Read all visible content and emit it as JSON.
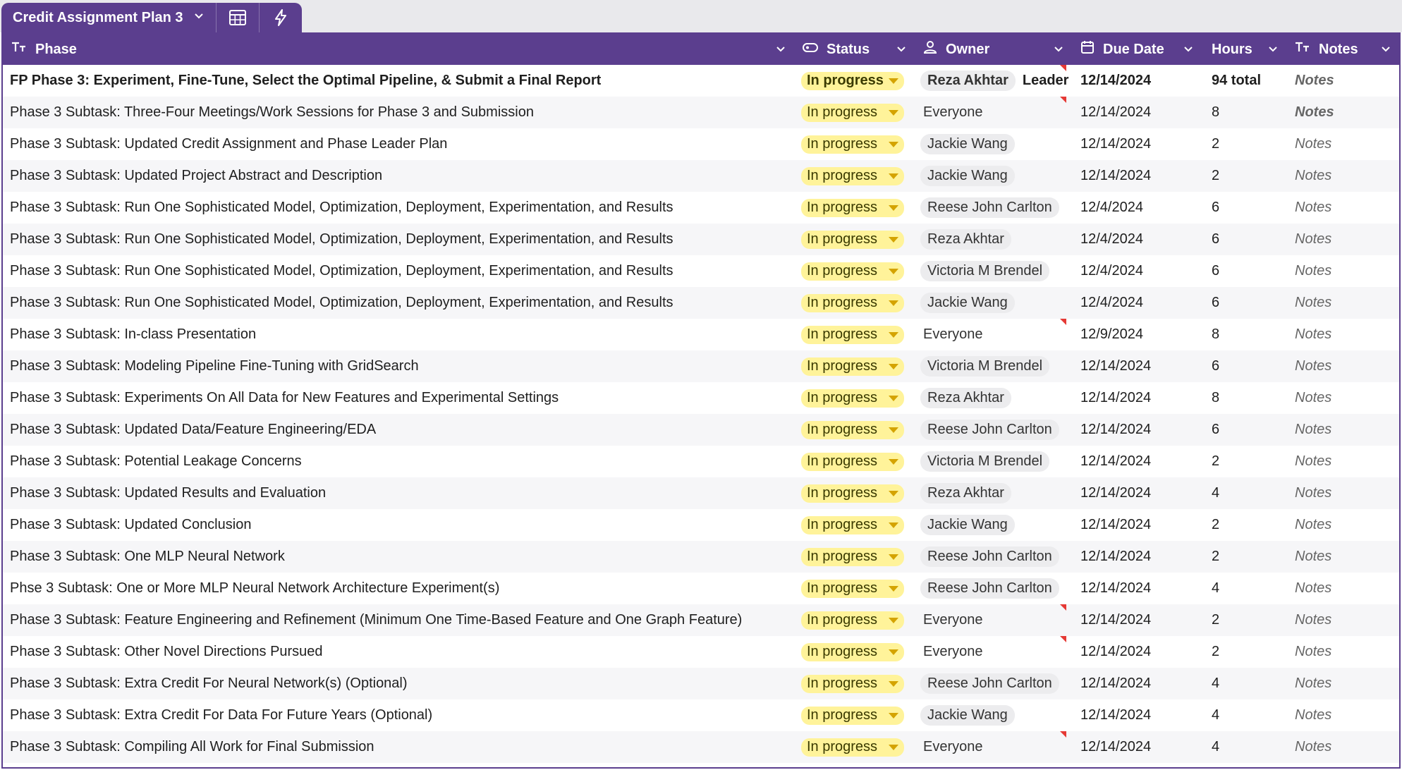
{
  "tab": {
    "title": "Credit Assignment Plan 3"
  },
  "columns": {
    "phase": "Phase",
    "status": "Status",
    "owner": "Owner",
    "due": "Due Date",
    "hours": "Hours",
    "notes": "Notes"
  },
  "rows": [
    {
      "phase": "FP Phase 3: Experiment, Fine-Tune, Select the Optimal Pipeline, & Submit a Final Report",
      "status": "In progress",
      "owner": "Reza Akhtar",
      "owner_extra": "Leader",
      "due": "12/14/2024",
      "hours": "94 total",
      "notes": "Notes"
    },
    {
      "phase": "Phase 3 Subtask: Three-Four Meetings/Work Sessions for Phase 3 and Submission",
      "status": "In progress",
      "owner": "Everyone",
      "due": "12/14/2024",
      "hours": "8",
      "notes": "Notes"
    },
    {
      "phase": "Phase 3 Subtask: Updated Credit Assignment and Phase Leader Plan",
      "status": "In progress",
      "owner": "Jackie Wang",
      "due": "12/14/2024",
      "hours": "2",
      "notes": "Notes"
    },
    {
      "phase": "Phase 3 Subtask: Updated Project Abstract and Description",
      "status": "In progress",
      "owner": "Jackie Wang",
      "due": "12/14/2024",
      "hours": "2",
      "notes": "Notes"
    },
    {
      "phase": "Phase 3 Subtask: Run One Sophisticated Model, Optimization, Deployment, Experimentation, and Results",
      "status": "In progress",
      "owner": "Reese John Carlton",
      "due": "12/4/2024",
      "hours": "6",
      "notes": "Notes"
    },
    {
      "phase": "Phase 3 Subtask: Run One Sophisticated Model, Optimization, Deployment, Experimentation, and Results",
      "status": "In progress",
      "owner": "Reza Akhtar",
      "due": "12/4/2024",
      "hours": "6",
      "notes": "Notes"
    },
    {
      "phase": "Phase 3 Subtask: Run One Sophisticated Model, Optimization, Deployment, Experimentation, and Results",
      "status": "In progress",
      "owner": "Victoria M Brendel",
      "due": "12/4/2024",
      "hours": "6",
      "notes": "Notes"
    },
    {
      "phase": "Phase 3 Subtask: Run One Sophisticated Model, Optimization, Deployment, Experimentation, and Results",
      "status": "In progress",
      "owner": "Jackie Wang",
      "due": "12/4/2024",
      "hours": "6",
      "notes": "Notes"
    },
    {
      "phase": "Phase 3 Subtask:  In-class Presentation",
      "status": "In progress",
      "owner": "Everyone",
      "due": "12/9/2024",
      "hours": "8",
      "notes": "Notes"
    },
    {
      "phase": "Phase 3 Subtask: Modeling Pipeline Fine-Tuning with GridSearch",
      "status": "In progress",
      "owner": "Victoria M Brendel",
      "due": "12/14/2024",
      "hours": "6",
      "notes": "Notes"
    },
    {
      "phase": "Phase 3 Subtask: Experiments On All Data for New Features and Experimental Settings",
      "status": "In progress",
      "owner": "Reza Akhtar",
      "due": "12/14/2024",
      "hours": "8",
      "notes": "Notes"
    },
    {
      "phase": "Phase 3 Subtask: Updated Data/Feature Engineering/EDA",
      "status": "In progress",
      "owner": "Reese John Carlton",
      "due": "12/14/2024",
      "hours": "6",
      "notes": "Notes"
    },
    {
      "phase": "Phase 3 Subtask: Potential Leakage Concerns",
      "status": "In progress",
      "owner": "Victoria M Brendel",
      "due": "12/14/2024",
      "hours": "2",
      "notes": "Notes"
    },
    {
      "phase": "Phase 3 Subtask: Updated Results and Evaluation",
      "status": "In progress",
      "owner": "Reza Akhtar",
      "due": "12/14/2024",
      "hours": "4",
      "notes": "Notes"
    },
    {
      "phase": "Phase 3 Subtask: Updated Conclusion",
      "status": "In progress",
      "owner": "Jackie Wang",
      "due": "12/14/2024",
      "hours": "2",
      "notes": "Notes"
    },
    {
      "phase": "Phase 3 Subtask: One MLP Neural Network",
      "status": "In progress",
      "owner": "Reese John Carlton",
      "due": "12/14/2024",
      "hours": "2",
      "notes": "Notes"
    },
    {
      "phase": "Phse 3 Subtask: One or More MLP Neural Network Architecture Experiment(s)",
      "status": "In progress",
      "owner": "Reese John Carlton",
      "due": "12/14/2024",
      "hours": "4",
      "notes": "Notes"
    },
    {
      "phase": "Phase 3 Subtask: Feature Engineering and Refinement (Minimum One Time-Based Feature and One Graph Feature)",
      "status": "In progress",
      "owner": "Everyone",
      "due": "12/14/2024",
      "hours": "2",
      "notes": "Notes"
    },
    {
      "phase": "Phase 3 Subtask: Other Novel Directions Pursued",
      "status": "In progress",
      "owner": "Everyone",
      "due": "12/14/2024",
      "hours": "2",
      "notes": "Notes"
    },
    {
      "phase": "Phase 3 Subtask: Extra Credit For Neural Network(s) (Optional)",
      "status": "In progress",
      "owner": "Reese John Carlton",
      "due": "12/14/2024",
      "hours": "4",
      "notes": "Notes"
    },
    {
      "phase": "Phase 3 Subtask: Extra Credit For Data For Future Years (Optional)",
      "status": "In progress",
      "owner": "Jackie Wang",
      "due": "12/14/2024",
      "hours": "4",
      "notes": "Notes"
    },
    {
      "phase": "Phase 3 Subtask: Compiling All Work for Final Submission",
      "status": "In progress",
      "owner": "Everyone",
      "due": "12/14/2024",
      "hours": "4",
      "notes": "Notes"
    }
  ],
  "colors": {
    "accent": "#5b3e8e",
    "status_pill": "#fff39a",
    "chip": "#ececee",
    "comment_flag": "#e53935"
  },
  "icons": {
    "tab": [
      "chevron-down-icon",
      "calculator-icon",
      "lightning-bolt-icon"
    ],
    "columns": [
      "text-type-icon",
      "status-tag-icon",
      "person-icon",
      "calendar-icon",
      "text-type-icon"
    ]
  }
}
